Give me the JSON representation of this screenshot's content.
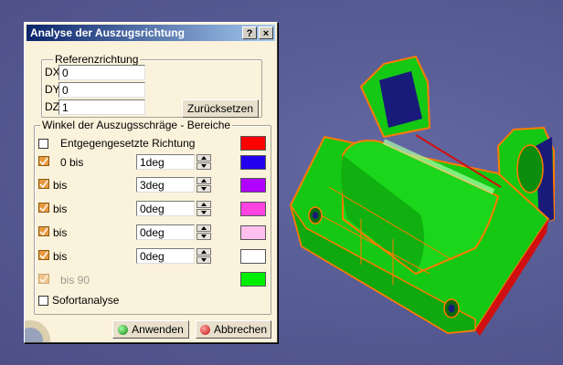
{
  "dialog": {
    "title": "Analyse der Auszugsrichtung",
    "help_label": "?",
    "close_label": "×",
    "reference": {
      "legend": "Referenzrichtung",
      "dx_label": "DX",
      "dx_value": "0",
      "dy_label": "DY",
      "dy_value": "0",
      "dz_label": "DZ",
      "dz_value": "1",
      "reset_label": "Zurücksetzen"
    },
    "angles": {
      "legend": "Winkel der Auszugsschräge - Bereiche",
      "opposite_label": "Entgegengesetzte Richtung",
      "opposite_color": "#ff0000",
      "rows": [
        {
          "label": "0 bis",
          "value": "1deg",
          "color": "#2200ee"
        },
        {
          "label": "bis",
          "value": "3deg",
          "color": "#b000ff"
        },
        {
          "label": "bis",
          "value": "0deg",
          "color": "#ff44e0"
        },
        {
          "label": "bis",
          "value": "0deg",
          "color": "#ffc0f0"
        },
        {
          "label": "bis",
          "value": "0deg",
          "color": "#ffffff"
        }
      ],
      "last_label": "bis 90",
      "last_color": "#00ee00",
      "instant_label": "Sofortanalyse"
    },
    "apply_label": "Anwenden",
    "cancel_label": "Abbrechen"
  }
}
